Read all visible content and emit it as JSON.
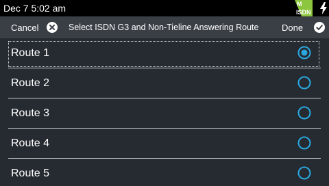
{
  "status_bar": {
    "time": "Dec 7 5:02 am",
    "badge_top": "M",
    "badge_bottom": "ISDN",
    "icons": [
      "isdn-badge-icon",
      "charging-bolt-icon"
    ]
  },
  "header": {
    "cancel_label": "Cancel",
    "title": "Select ISDN G3 and Non-Tieline Answering Route",
    "done_label": "Done",
    "icons": [
      "close-circle-icon",
      "check-circle-icon"
    ]
  },
  "routes": [
    {
      "label": "Route 1",
      "selected": true
    },
    {
      "label": "Route 2",
      "selected": false
    },
    {
      "label": "Route 3",
      "selected": false
    },
    {
      "label": "Route 4",
      "selected": false
    },
    {
      "label": "Route 5",
      "selected": false
    }
  ],
  "colors": {
    "accent": "#29a8e0",
    "badge_green": "#8cc63f",
    "background": "#262b31",
    "header_bg": "#3a3f46"
  }
}
